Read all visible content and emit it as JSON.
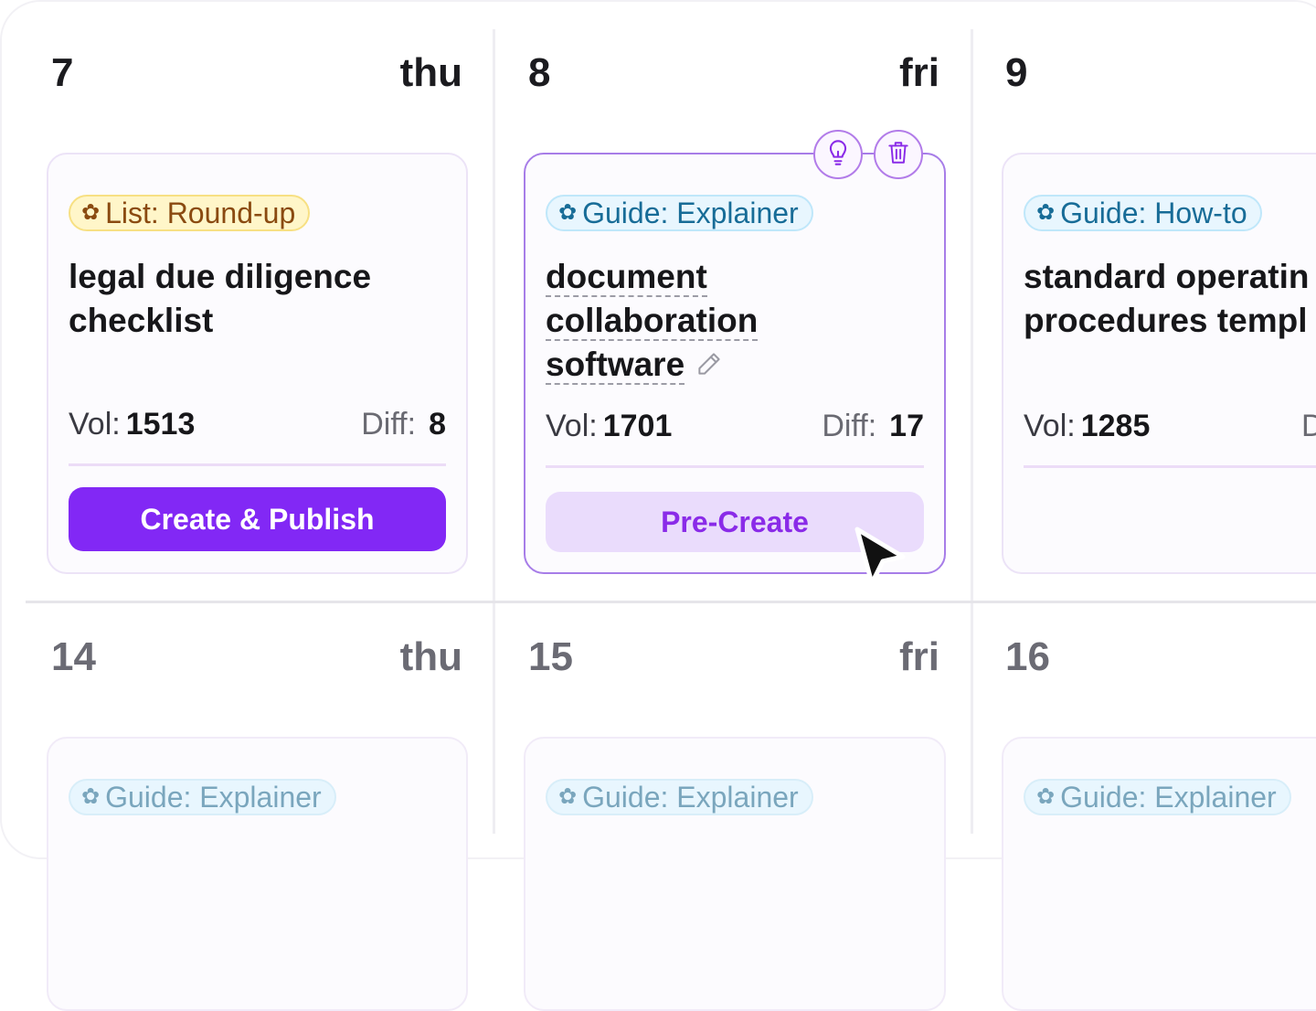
{
  "days": [
    {
      "num": "7",
      "name": "thu"
    },
    {
      "num": "8",
      "name": "fri"
    },
    {
      "num": "9",
      "name": ""
    },
    {
      "num": "14",
      "name": "thu"
    },
    {
      "num": "15",
      "name": "fri"
    },
    {
      "num": "16",
      "name": ""
    }
  ],
  "cards": [
    {
      "tag": "List: Round-up",
      "title_line1": "legal due diligence",
      "title_line2": "checklist",
      "vol_label": "Vol:",
      "vol": "1513",
      "diff_label": "Diff:",
      "diff": "8",
      "button": "Create & Publish"
    },
    {
      "tag": "Guide: Explainer",
      "title_line1": "document",
      "title_line2": "collaboration",
      "title_line3": "software",
      "vol_label": "Vol:",
      "vol": "1701",
      "diff_label": "Diff:",
      "diff": "17",
      "button": "Pre-Create"
    },
    {
      "tag": "Guide: How-to",
      "title_line1": "standard operatin",
      "title_line2": "procedures templ",
      "vol_label": "Vol:",
      "vol": "1285",
      "diff_label": "D"
    },
    {
      "tag": "Guide: Explainer"
    },
    {
      "tag": "Guide: Explainer"
    },
    {
      "tag": "Guide: Explainer"
    }
  ],
  "icons": {
    "tag": "gear-icon",
    "idea": "lightbulb-icon",
    "delete": "trash-icon",
    "edit": "pencil-icon",
    "pointer": "cursor-arrow-icon"
  },
  "colors": {
    "accent": "#8228f5",
    "accent_soft": "#eadcfc",
    "selected_border": "#a77de8",
    "tag_yellow_bg": "#fff6c9",
    "tag_blue_bg": "#e8f6fe"
  }
}
